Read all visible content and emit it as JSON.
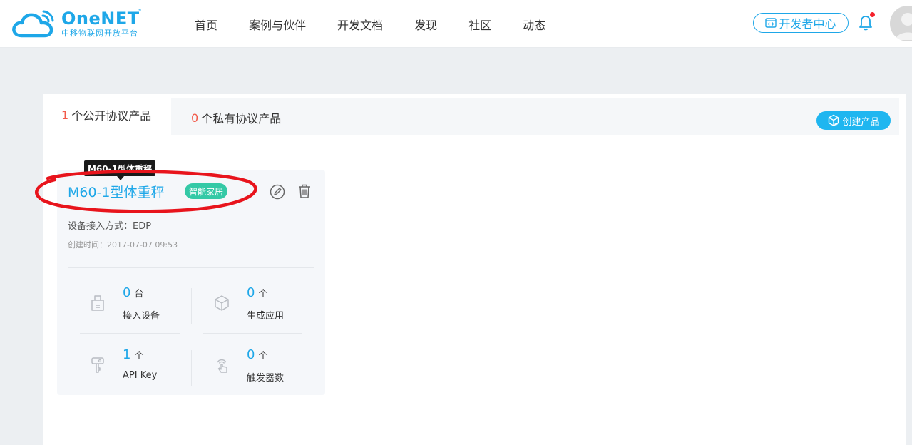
{
  "header": {
    "logo_name": "OneNET",
    "logo_tm": "™",
    "logo_subtitle": "中移物联网开放平台",
    "nav": [
      "首页",
      "案例与伙伴",
      "开发文档",
      "发现",
      "社区",
      "动态"
    ],
    "dev_center_label": "开发者中心",
    "brand_color": "#1ea7e8"
  },
  "tabs": {
    "public": {
      "count": "1",
      "label": "个公开协议产品"
    },
    "private": {
      "count": "0",
      "label": "个私有协议产品"
    }
  },
  "create_button_label": "创建产品",
  "tooltip": "M60-1型体重秤",
  "product": {
    "name": "M60-1型体重秤",
    "tag": "智能家居",
    "access_method": "设备接入方式：EDP",
    "created_time": "创建时间：2017-07-07 09:53",
    "stats": [
      {
        "value": "0",
        "unit": "台",
        "label": "接入设备",
        "icon": "device-icon"
      },
      {
        "value": "0",
        "unit": "个",
        "label": "生成应用",
        "icon": "cube-icon"
      },
      {
        "value": "1",
        "unit": "个",
        "label": "API Key",
        "icon": "key-icon"
      },
      {
        "value": "0",
        "unit": "个",
        "label": "触发器数",
        "icon": "trigger-icon"
      }
    ]
  },
  "colors": {
    "accent": "#1ea7e8",
    "count_red": "#f25a4a",
    "tag_green": "#34c9a6",
    "annotation_red": "#e8141c"
  }
}
